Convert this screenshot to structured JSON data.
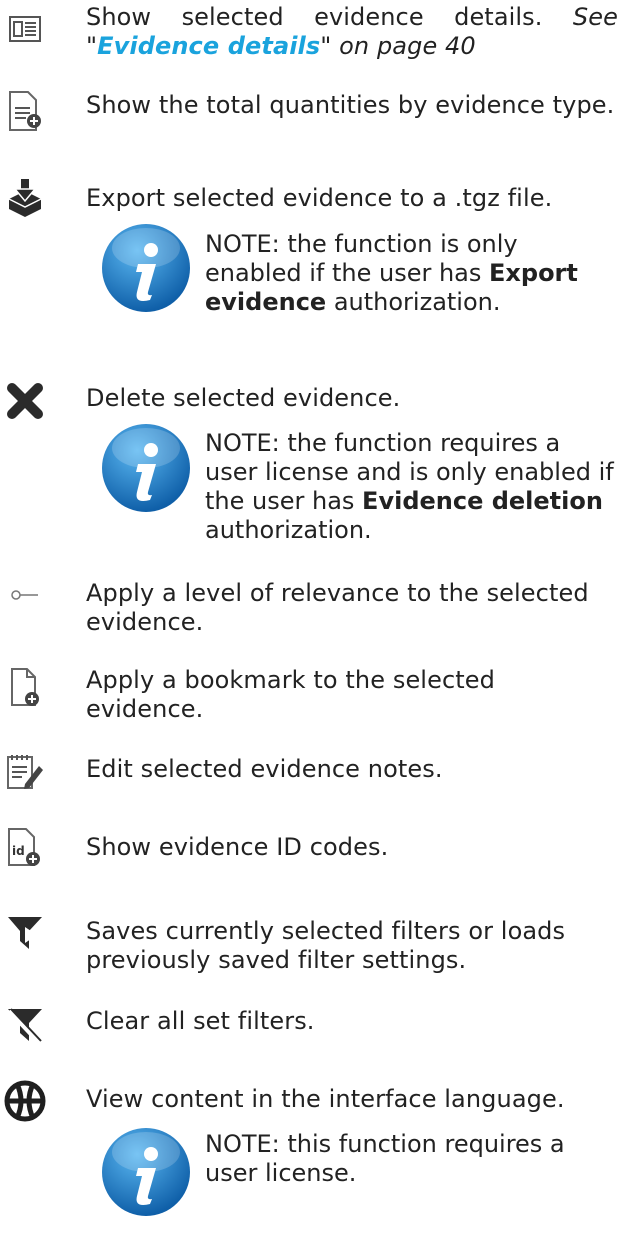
{
  "items": [
    {
      "icon": "evidence-details-icon",
      "text": "Show selected evidence details. ",
      "see_prefix": "See \"",
      "link_text": "Evidence details",
      "see_suffix": "\" on page 40"
    },
    {
      "icon": "totals-add-icon",
      "text": "Show the total quantities by evidence type."
    },
    {
      "icon": "export-tray-icon",
      "text": "Export selected evidence to a .tgz file."
    },
    {
      "icon": "close-x-icon",
      "text": "Delete selected evidence."
    },
    {
      "icon": "relevance-slider-icon",
      "text": "Apply a level of relevance to the selected evidence."
    },
    {
      "icon": "bookmark-add-icon",
      "text": "Apply a bookmark to the selected evidence."
    },
    {
      "icon": "edit-notes-icon",
      "text": "Edit selected evidence notes."
    },
    {
      "icon": "id-codes-icon",
      "text": "Show evidence ID codes."
    },
    {
      "icon": "filter-save-icon",
      "text": "Saves currently selected filters or loads previously saved filter settings."
    },
    {
      "icon": "filter-clear-icon",
      "text": "Clear all set filters."
    },
    {
      "icon": "globe-icon",
      "text": "View content in the interface language."
    }
  ],
  "notes": [
    {
      "icon": "info-icon",
      "before": "NOTE: the function is only enabled if the user has ",
      "bold": "Export evidence",
      "after": " authorization."
    },
    {
      "icon": "info-icon",
      "before": "NOTE: the function requires a user license and is only enabled if the user has ",
      "bold": "Evidence deletion",
      "after": " authorization."
    },
    {
      "icon": "info-icon",
      "before": "NOTE: this function requires a user license.",
      "bold": "",
      "after": ""
    }
  ],
  "colors": {
    "link": "#1aa3dd",
    "icon": "#2b2b2b",
    "info_blue": "#1877c4"
  }
}
